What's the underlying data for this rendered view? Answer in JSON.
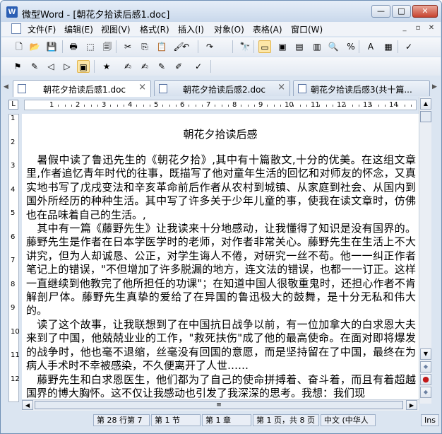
{
  "window": {
    "title": "微型Word - [朝花夕拾读后感1.doc]",
    "app_icon_letter": "W"
  },
  "window_buttons": {
    "minimize": "—",
    "maximize": "□",
    "close": "✕"
  },
  "menubar": {
    "items": [
      "文件(F)",
      "编辑(E)",
      "视图(V)",
      "格式(R)",
      "插入(I)",
      "对象(O)",
      "表格(A)",
      "窗口(W)"
    ],
    "mdi_buttons": [
      "_",
      "▫",
      "✕"
    ]
  },
  "toolbar1": {
    "icons": [
      "new-doc-icon",
      "open-folder-icon",
      "save-icon",
      "print-icon",
      "pdf-icon",
      "print-preview-icon",
      "cut-icon",
      "copy-icon",
      "paste-icon",
      "format-painter-icon",
      "undo-icon",
      "redo-icon",
      "find-icon",
      "ruler-icon",
      "tab-view-icon",
      "page-view-icon",
      "outline-view-icon",
      "zoom-icon",
      "percent-icon",
      "font-color-icon",
      "picture-icon",
      "spellcheck-icon"
    ],
    "glyphs": [
      "🗋",
      "📂",
      "💾",
      "🖶",
      "⬚",
      "🗐",
      "✂",
      "⎘",
      "📋",
      "🖌",
      "↶",
      "↷",
      "🔭",
      "▭",
      "▣",
      "▤",
      "▥",
      "🔍",
      "%",
      "A",
      "▦",
      "✓"
    ]
  },
  "toolbar2": {
    "icons": [
      "insert-note-icon",
      "edit-note-icon",
      "note-prev-icon",
      "note-next-icon",
      "notes-pane-icon",
      "note-1-icon",
      "note-2-icon",
      "note-3-icon",
      "note-4-icon",
      "note-5-icon",
      "comments-icon"
    ],
    "glyphs": [
      "⚑",
      "✎",
      "◁",
      "▷",
      "▣",
      "★",
      "✍",
      "✍",
      "✎",
      "✐",
      "✓"
    ]
  },
  "tabs": [
    {
      "label": "朝花夕拾读后感1.doc",
      "close": "×",
      "active": true
    },
    {
      "label": "朝花夕拾读后感2.doc",
      "close": "×",
      "active": false
    },
    {
      "label": "朝花夕拾读后感3(共十篇...",
      "close": "×",
      "active": false
    }
  ],
  "tab_arrows": {
    "left": "◀",
    "right": "▶"
  },
  "ruler": {
    "corner": "L",
    "h_numbers": [
      "1",
      "2",
      "3",
      "4",
      "5",
      "6",
      "7",
      "8",
      "9",
      "10",
      "11",
      "12",
      "13",
      "14"
    ],
    "v_numbers": [
      "1",
      "2",
      "3",
      "4",
      "5",
      "6",
      "7",
      "8",
      "9",
      "10",
      "11",
      "12"
    ]
  },
  "document": {
    "title": "朝花夕拾读后感",
    "paragraphs": [
      "　暑假中读了鲁迅先生的《朝花夕拾》,其中有十篇散文,十分的优美。在这组文章里,作者追忆青年时代的往事，既描写了他对童年生活的回忆和对师友的怀念，又真实地书写了戊戌变法和辛亥革命前后作者从农村到城镇、从家庭到社会、从国内到国外所经历的种种生活。其中写了许多关于少年儿童的事，使我在读文章时，仿佛也在品味着自己的生活。,",
      "　其中有一篇《藤野先生》让我读来十分地感动，让我懂得了知识是没有国界的。藤野先生是作者在日本学医学时的老师，对作者非常关心。藤野先生在生活上不大讲究，但为人却诚恳、公正，对学生诲人不倦，对研究一丝不苟。他一一纠正作者笔记上的错误，\"不但增加了许多脱漏的地方，连文法的错误，也都一一订正。这样一直继续到他教完了他所担任的功课\"；在知道中国人很敬重鬼时，还担心作者不肯解剖尸体。藤野先生真挚的爱给了在异国的鲁迅极大的鼓舞，是十分无私和伟大的。",
      "　读了这个故事，让我联想到了在中国抗日战争以前，有一位加拿大的白求恩大夫来到了中国，他兢兢业业的工作，\"救死扶伤\"成了他的最高使命。在面对即将爆发的战争时，他也毫不退缩，丝毫没有回国的意愿，而是坚持留在了中国，最终在为病人手术时不幸被感染，不久便离开了人世……",
      "　藤野先生和白求恩医生，他们都为了自己的使命拼搏着、奋斗着，而且有着超越国界的博大胸怀。这不仅让我感动也引发了我深深的思考。我想：我们现"
    ]
  },
  "scrollbar": {
    "up": "▲",
    "down": "▼",
    "left": "◀",
    "right": "▶",
    "grip": "≡"
  },
  "statusbar": {
    "items": [
      "第 28 行第 7",
      "第 1 节",
      "第 1 章",
      "第 1 页，共 8 页",
      "中文 (中华人",
      "Ins"
    ]
  }
}
